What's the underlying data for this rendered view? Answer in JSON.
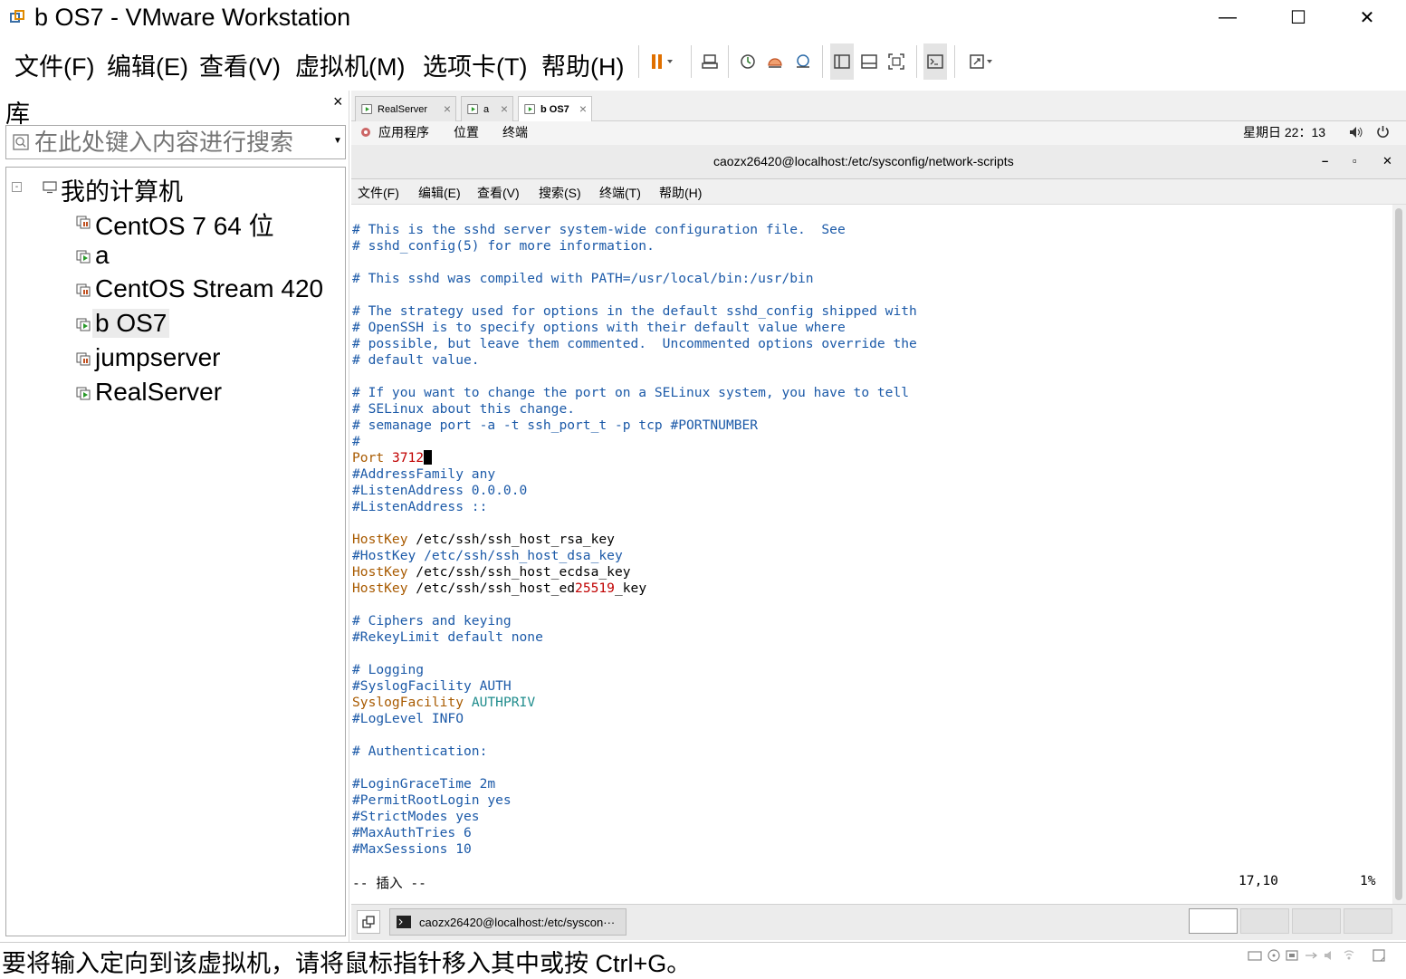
{
  "window": {
    "title": "b OS7 - VMware Workstation",
    "minimize": "—",
    "maximize": "☐",
    "close": "✕"
  },
  "menu": {
    "items": [
      "文件(F)",
      "编辑(E)",
      "查看(V)",
      "虚拟机(M)",
      "选项卡(T)",
      "帮助(H)"
    ]
  },
  "toolbar": {
    "icons": [
      "pause-icon",
      "send-keys-icon",
      "snapshot-icon",
      "revert-snapshot-icon",
      "snapshot-manager-icon",
      "library-view-icon",
      "thumbnail-view-icon",
      "fullscreen-icon",
      "console-view-icon",
      "stretch-icon"
    ]
  },
  "library": {
    "title": "库",
    "close": "×",
    "search_placeholder": "在此处键入内容进行搜索",
    "root": "我的计算机",
    "collapse": "-",
    "vms": [
      "CentOS 7 64 位",
      "a",
      "CentOS Stream 420",
      "b OS7",
      "jumpserver",
      "RealServer"
    ],
    "selected": "b OS7"
  },
  "tabs": [
    {
      "label": "RealServer",
      "close": "×"
    },
    {
      "label": "a",
      "close": "×"
    },
    {
      "label": "b OS7",
      "close": "×"
    }
  ],
  "gnome": {
    "apps": "应用程序",
    "places": "位置",
    "terminal": "终端",
    "clock": "星期日 22：13"
  },
  "terminal": {
    "title": "caozx26420@localhost:/etc/sysconfig/network-scripts",
    "buttons": [
      "–",
      "▫",
      "✕"
    ],
    "menu": [
      "文件(F)",
      "编辑(E)",
      "查看(V)",
      "搜索(S)",
      "终端(T)",
      "帮助(H)"
    ],
    "lines": [
      "# This is the sshd server system-wide configuration file.  See",
      "# sshd_config(5) for more information.",
      "",
      "# This sshd was compiled with PATH=/usr/local/bin:/usr/bin",
      "",
      "# The strategy used for options in the default sshd_config shipped with",
      "# OpenSSH is to specify options with their default value where",
      "# possible, but leave them commented.  Uncommented options override the",
      "# default value.",
      "",
      "# If you want to change the port on a SELinux system, you have to tell",
      "# SELinux about this change.",
      "# semanage port -a -t ssh_port_t -p tcp #PORTNUMBER",
      "#",
      "Port 3712",
      "#AddressFamily any",
      "#ListenAddress 0.0.0.0",
      "#ListenAddress ::",
      "",
      "HostKey /etc/ssh/ssh_host_rsa_key",
      "#HostKey /etc/ssh/ssh_host_dsa_key",
      "HostKey /etc/ssh/ssh_host_ecdsa_key",
      "HostKey /etc/ssh/ssh_host_ed25519_key",
      "",
      "# Ciphers and keying",
      "#RekeyLimit default none",
      "",
      "# Logging",
      "#SyslogFacility AUTH",
      "SyslogFacility AUTHPRIV",
      "#LogLevel INFO",
      "",
      "# Authentication:",
      "",
      "#LoginGraceTime 2m",
      "#PermitRootLogin yes",
      "#StrictModes yes",
      "#MaxAuthTries 6",
      "#MaxSessions 10"
    ],
    "mode": "-- 插入 --",
    "position": "17,10",
    "percent": "1%"
  },
  "taskbar": {
    "task": "caozx26420@localhost:/etc/syscon···"
  },
  "status": {
    "text": "要将输入定向到该虚拟机，请将鼠标指针移入其中或按 Ctrl+G。"
  },
  "colors": {
    "comment": "#1c5aa8",
    "keyword": "#a85a00",
    "number": "#c00000",
    "value": "#1f8c8c",
    "pause": "#e07000"
  }
}
